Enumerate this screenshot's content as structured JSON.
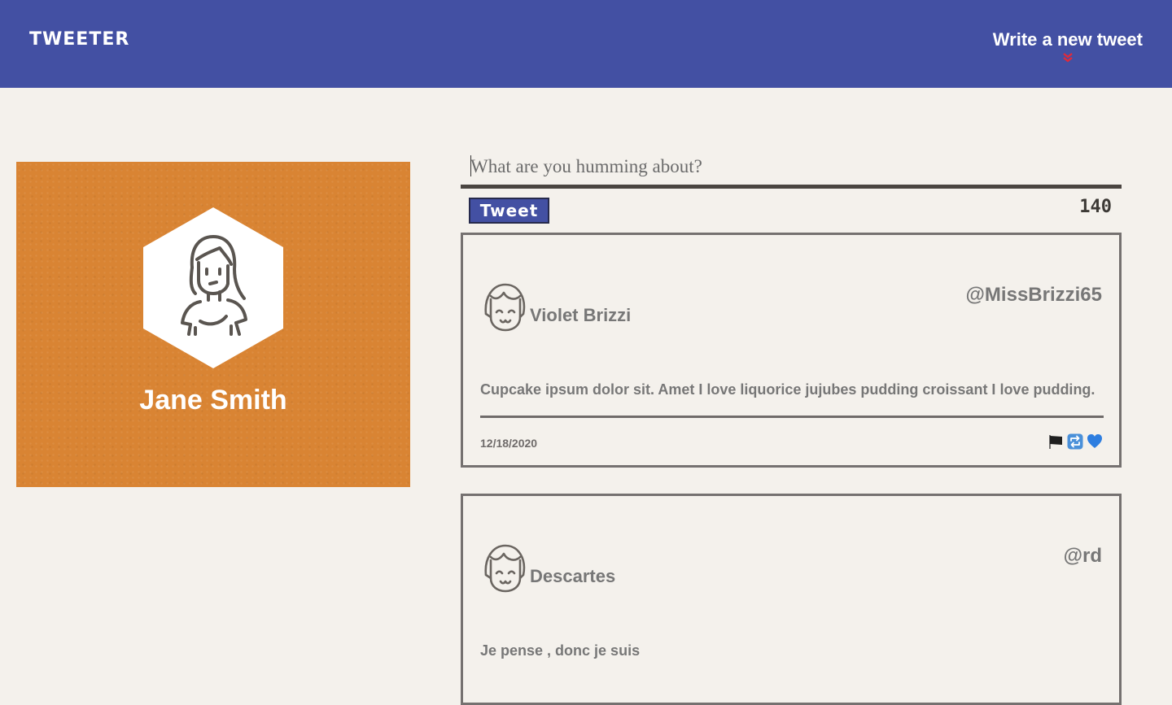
{
  "nav": {
    "brand": "Tweeter",
    "compose_link": "Write a new tweet",
    "compose_arrow": "»"
  },
  "profile": {
    "name": "Jane Smith"
  },
  "compose": {
    "placeholder": "What are you humming about?",
    "button_label": "Tweet",
    "counter": "140"
  },
  "tweets": [
    {
      "name": "Violet Brizzi",
      "handle": "@MissBrizzi65",
      "text": "Cupcake ipsum dolor sit. Amet I love liquorice jujubes pudding croissant I love pudding.",
      "date": "12/18/2020",
      "actions": [
        "flag-icon",
        "retweet-icon",
        "heart-icon"
      ]
    },
    {
      "name": "Descartes",
      "handle": "@rd",
      "text": "Je pense , donc je suis"
    }
  ],
  "colors": {
    "nav_bg": "#4350a3",
    "page_bg": "#f4f1ec",
    "profile_bg": "#d98433",
    "accent_red": "#e12a3a",
    "tweet_text": "#777777"
  }
}
